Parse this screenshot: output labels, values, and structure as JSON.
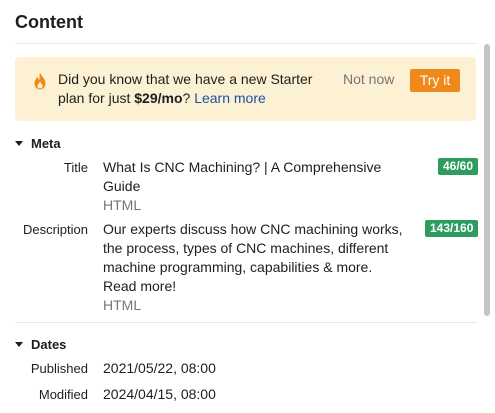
{
  "panel": {
    "title": "Content"
  },
  "notice": {
    "text_before": "Did you know that we have a new Starter plan for just ",
    "price": "$29/mo",
    "text_after": "? ",
    "link_label": "Learn more",
    "dismiss_label": "Not now",
    "cta_label": "Try it",
    "icon": "flame-icon",
    "accent_color": "#f0891b"
  },
  "meta": {
    "heading": "Meta",
    "title": {
      "label": "Title",
      "value": "What Is CNC Machining? | A Comprehensive Guide",
      "format": "HTML",
      "counter": "46/60"
    },
    "description": {
      "label": "Description",
      "value": "Our experts discuss how CNC machining works, the process, types of CNC machines, different machine programming, capabilities & more. Read more!",
      "format": "HTML",
      "counter": "143/160"
    },
    "counter_color": "#2f9c5f"
  },
  "dates": {
    "heading": "Dates",
    "published": {
      "label": "Published",
      "value": "2021/05/22, 08:00"
    },
    "modified": {
      "label": "Modified",
      "value": "2024/04/15, 08:00"
    }
  }
}
